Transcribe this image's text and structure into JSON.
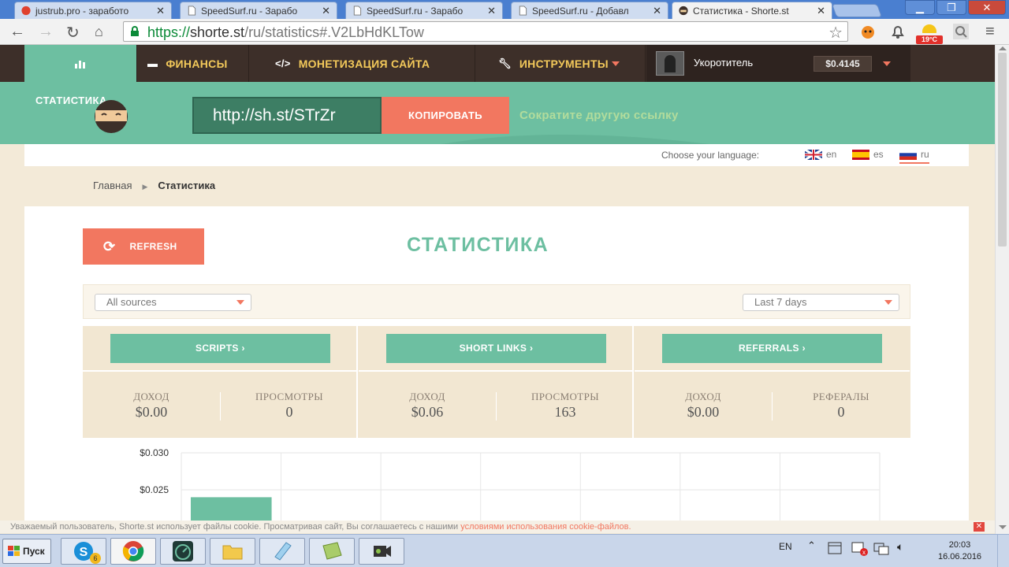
{
  "browser": {
    "tabs": [
      {
        "title": "justrub.pro - заработо"
      },
      {
        "title": "SpeedSurf.ru - Зарабо"
      },
      {
        "title": "SpeedSurf.ru - Зарабо"
      },
      {
        "title": "SpeedSurf.ru - Добавл"
      },
      {
        "title": "Статистика - Shorte.st"
      }
    ],
    "url_scheme": "https://",
    "url_host": "shorte.st",
    "url_path": "/ru/statistics#.V2LbHdKLTow",
    "weather": "19°C"
  },
  "nav": {
    "finance": "ФИНАНСЫ",
    "monetize": "МОНЕТИЗАЦИЯ САЙТА",
    "tools": "ИНСТРУМЕНТЫ",
    "username": "Укоротитель",
    "balance": "$0.4145"
  },
  "banner": {
    "title": "СТАТИСТИКА",
    "short_url": "http://sh.st/STrZr",
    "copy": "КОПИРОВАТЬ",
    "shorten_another": "Сократите другую ссылку"
  },
  "lang": {
    "label": "Choose your language:",
    "options": [
      "en",
      "es",
      "ru"
    ]
  },
  "breadcrumb": {
    "home": "Главная",
    "current": "Статистика"
  },
  "main": {
    "refresh": "REFRESH",
    "title": "СТАТИСТИКА",
    "source_filter": "All sources",
    "period_filter": "Last 7 days"
  },
  "stats": [
    {
      "button": "SCRIPTS  ›",
      "m1_label": "ДОХОД",
      "m1_value": "$0.00",
      "m2_label": "ПРОСМОТРЫ",
      "m2_value": "0"
    },
    {
      "button": "SHORT LINKS  ›",
      "m1_label": "ДОХОД",
      "m1_value": "$0.06",
      "m2_label": "ПРОСМОТРЫ",
      "m2_value": "163"
    },
    {
      "button": "REFERRALS  ›",
      "m1_label": "ДОХОД",
      "m1_value": "$0.00",
      "m2_label": "РЕФЕРАЛЫ",
      "m2_value": "0"
    }
  ],
  "chart_data": {
    "type": "bar",
    "title": "",
    "y_ticks": [
      "$0.030",
      "$0.025"
    ],
    "ylim": [
      0.0,
      0.03
    ],
    "categories": [
      "",
      "",
      "",
      "",
      "",
      "",
      ""
    ],
    "values": [
      0.024,
      0,
      0,
      0,
      0,
      0,
      0
    ],
    "grid": true,
    "bar_color": "#6dbfa1"
  },
  "cookie": {
    "text": "Уважаемый пользователь, Shorte.st использует файлы cookie. Просматривая сайт, Вы соглашаетесь с нашими",
    "link1": "условиями использования",
    "link2": "cookie-файлов."
  },
  "taskbar": {
    "start": "Пуск",
    "skype_badge": "6",
    "lang": "EN",
    "time": "20:03",
    "date": "16.06.2016"
  },
  "colors": {
    "accent_green": "#6dbfa1",
    "accent_orange": "#f27760",
    "nav_dark": "#3d2f29",
    "nav_gold": "#f3c95a"
  }
}
